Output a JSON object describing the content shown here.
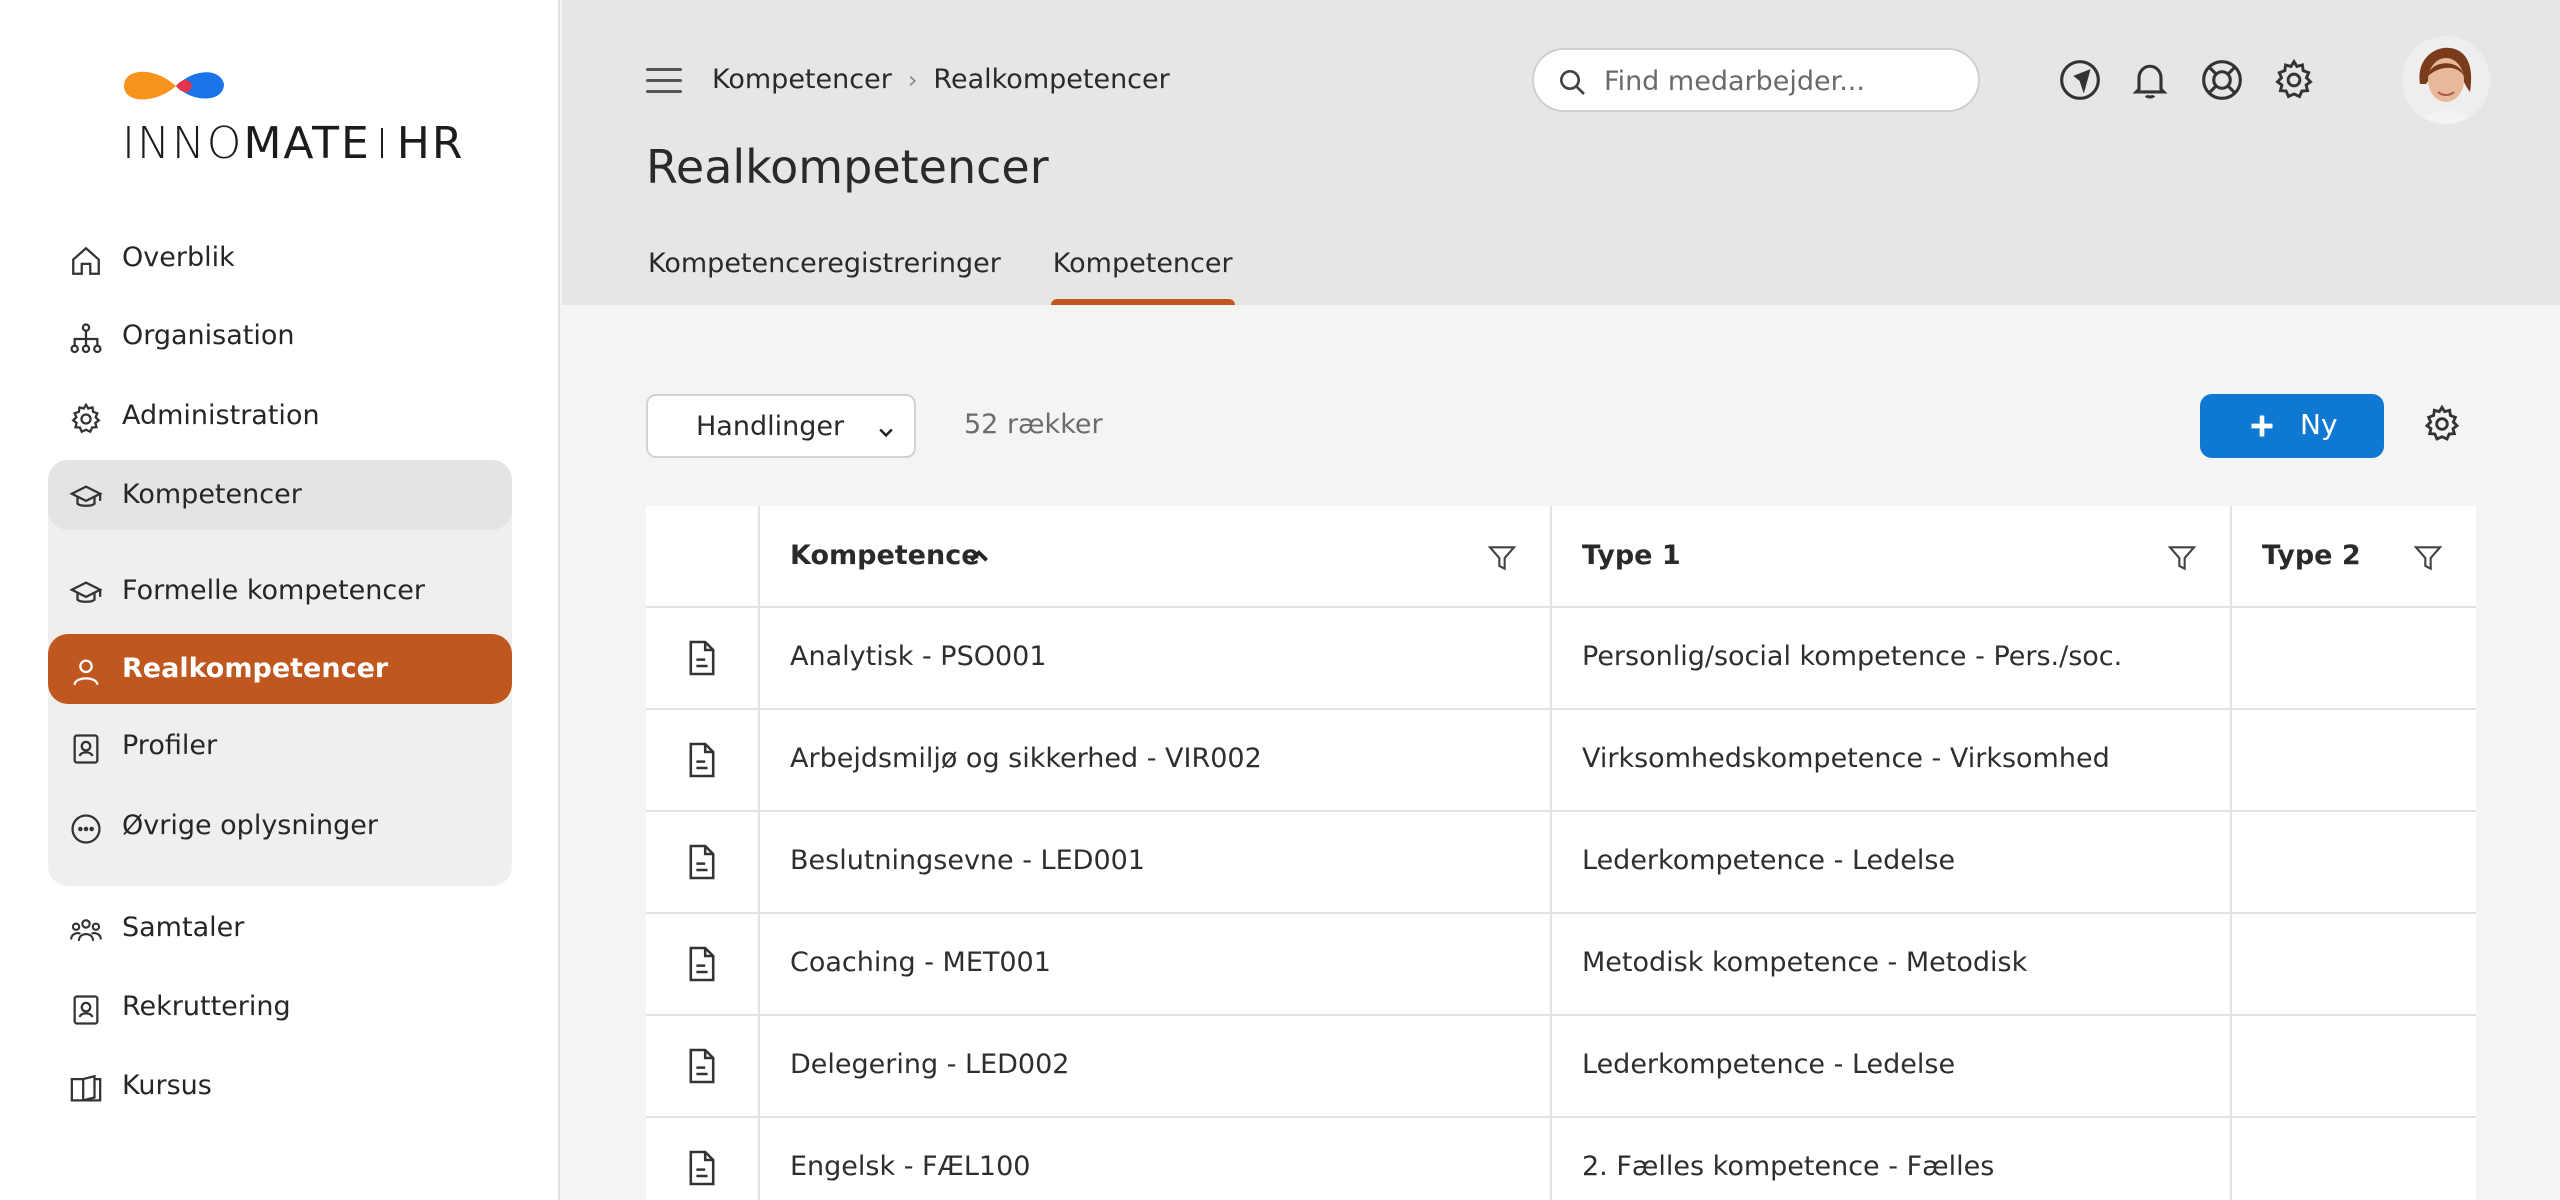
{
  "brand": {
    "name_thin": "INNO",
    "name_bold": "MATE",
    "suffix": "HR",
    "colors": {
      "orange": "#f7941d",
      "blue": "#1a73e8",
      "accent": "#c0571f",
      "primary_button": "#0f78d2"
    }
  },
  "sidebar": {
    "items": [
      {
        "label": "Overblik",
        "icon": "home-icon"
      },
      {
        "label": "Organisation",
        "icon": "org-chart-icon"
      },
      {
        "label": "Administration",
        "icon": "gear-icon"
      },
      {
        "label": "Kompetencer",
        "icon": "graduation-cap-icon"
      },
      {
        "label": "Formelle kompetencer",
        "icon": "graduation-cap-icon"
      },
      {
        "label": "Realkompetencer",
        "icon": "person-icon"
      },
      {
        "label": "Profiler",
        "icon": "profile-card-icon"
      },
      {
        "label": "Øvrige oplysninger",
        "icon": "more-circle-icon"
      },
      {
        "label": "Samtaler",
        "icon": "people-group-icon"
      },
      {
        "label": "Rekruttering",
        "icon": "profile-card-icon"
      },
      {
        "label": "Kursus",
        "icon": "book-open-icon"
      }
    ]
  },
  "header": {
    "breadcrumb": [
      "Kompetencer",
      "Realkompetencer"
    ],
    "title": "Realkompetencer",
    "search_placeholder": "Find medarbejder...",
    "icons": [
      "navigation-icon",
      "bell-icon",
      "lifebuoy-icon",
      "gear-icon"
    ],
    "tabs": [
      {
        "label": "Kompetenceregistreringer",
        "active": false
      },
      {
        "label": "Kompetencer",
        "active": true
      }
    ]
  },
  "toolbar": {
    "actions_label": "Handlinger",
    "row_count": "52 rækker",
    "new_label": "Ny"
  },
  "table": {
    "columns": [
      "Kompetence",
      "Type 1",
      "Type 2"
    ],
    "rows": [
      {
        "kompetence": "Analytisk - PSO001",
        "type1": "Personlig/social kompetence - Pers./soc.",
        "type2": ""
      },
      {
        "kompetence": "Arbejdsmiljø og sikkerhed - VIR002",
        "type1": "Virksomhedskompetence - Virksomhed",
        "type2": ""
      },
      {
        "kompetence": "Beslutningsevne - LED001",
        "type1": "Lederkompetence - Ledelse",
        "type2": ""
      },
      {
        "kompetence": "Coaching - MET001",
        "type1": "Metodisk kompetence - Metodisk",
        "type2": ""
      },
      {
        "kompetence": "Delegering - LED002",
        "type1": "Lederkompetence - Ledelse",
        "type2": ""
      },
      {
        "kompetence": "Engelsk - FÆL100",
        "type1": "2. Fælles kompetence - Fælles",
        "type2": ""
      }
    ]
  }
}
